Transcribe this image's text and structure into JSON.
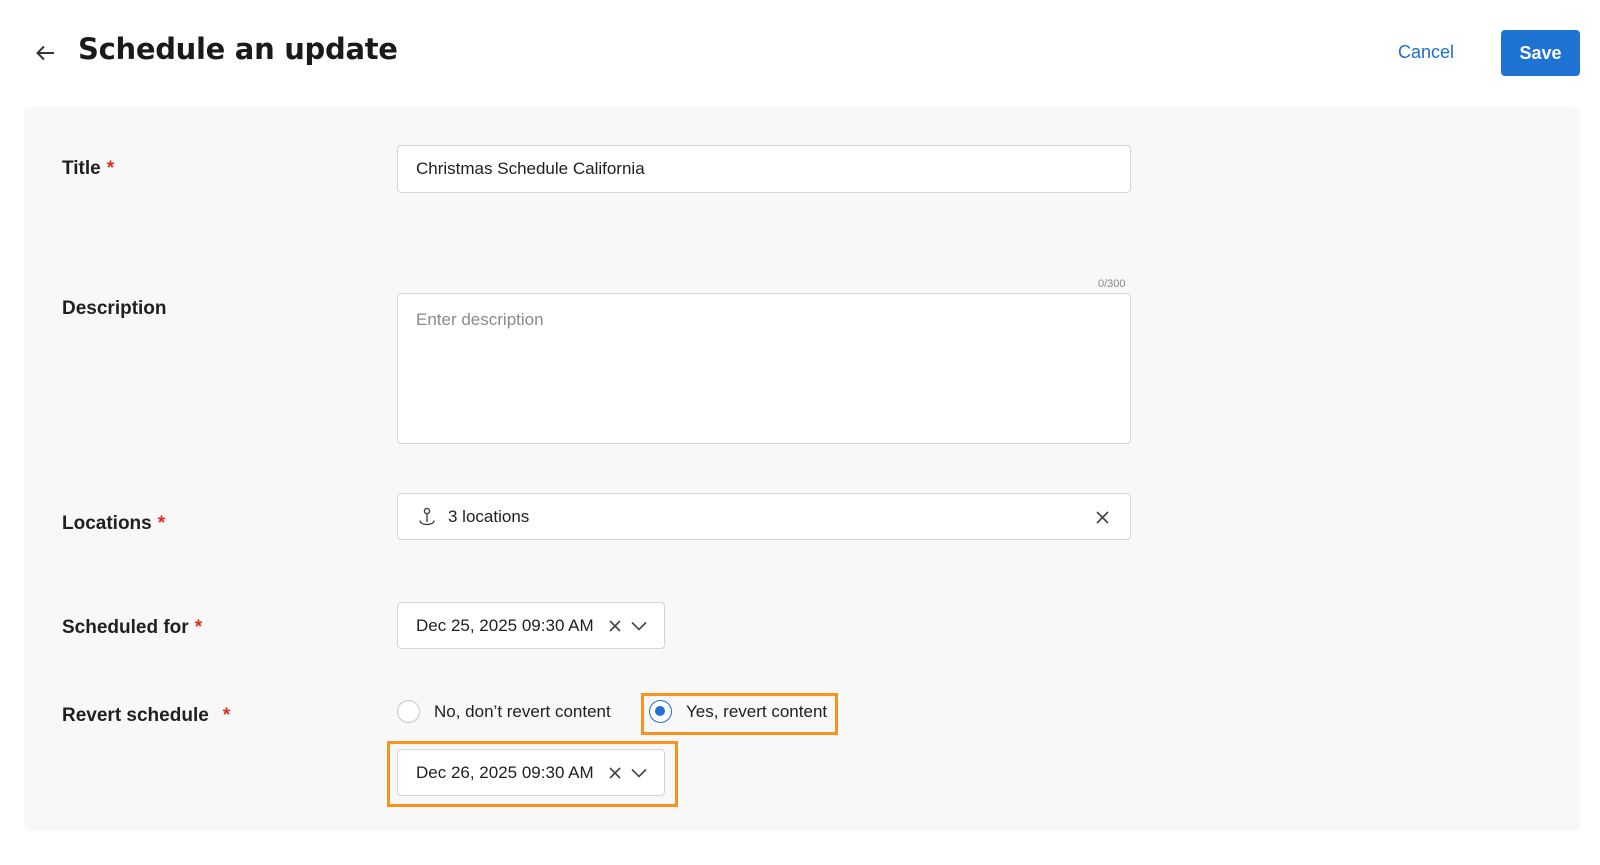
{
  "header": {
    "title": "Schedule an update",
    "cancel_label": "Cancel",
    "save_label": "Save"
  },
  "form": {
    "title": {
      "label": "Title",
      "required": "*",
      "value": "Christmas Schedule California"
    },
    "description": {
      "label": "Description",
      "placeholder": "Enter description",
      "counter": "0/300"
    },
    "locations": {
      "label": "Locations",
      "required": "*",
      "value": "3 locations"
    },
    "scheduled_for": {
      "label": "Scheduled for",
      "required": "*",
      "value": "Dec 25, 2025 09:30 AM"
    },
    "revert_schedule": {
      "label": "Revert schedule",
      "required": "*",
      "options": [
        {
          "label": "No, don’t revert content",
          "selected": false
        },
        {
          "label": "Yes, revert content",
          "selected": true
        }
      ],
      "revert_date": "Dec 26, 2025 09:30 AM"
    }
  },
  "colors": {
    "accent": "#1e73d2",
    "required": "#e0291d",
    "highlight": "#f7931e",
    "panel": "#f8f8f8"
  },
  "icons": {
    "back": "arrow-left-icon",
    "location": "location-pin-icon",
    "clear": "close-icon",
    "dropdown": "chevron-down-icon"
  }
}
